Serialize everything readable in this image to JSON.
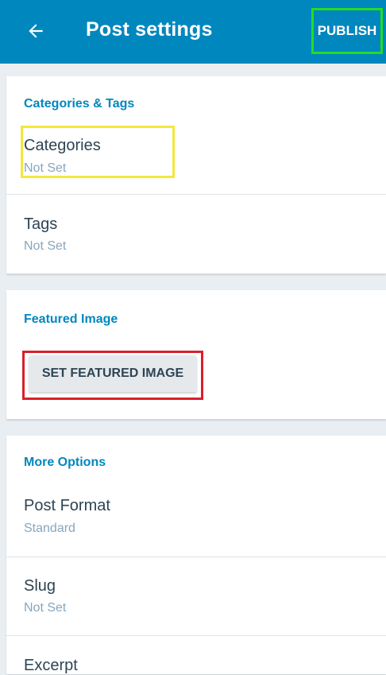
{
  "appbar": {
    "back_icon": "arrow-left-icon",
    "title": "Post settings",
    "publish_label": "PUBLISH"
  },
  "categories_tags": {
    "title": "Categories & Tags",
    "categories": {
      "label": "Categories",
      "value": "Not Set"
    },
    "tags": {
      "label": "Tags",
      "value": "Not Set"
    }
  },
  "featured_image": {
    "title": "Featured Image",
    "button_label": "SET FEATURED IMAGE"
  },
  "more_options": {
    "title": "More Options",
    "post_format": {
      "label": "Post Format",
      "value": "Standard"
    },
    "slug": {
      "label": "Slug",
      "value": "Not Set"
    },
    "excerpt": {
      "label": "Excerpt"
    }
  },
  "colors": {
    "appbar": "#0087be",
    "section_title": "#0087be",
    "publish_highlight": "#22dd22",
    "categories_highlight": "#f3e83a",
    "featured_highlight": "#d8202a"
  }
}
